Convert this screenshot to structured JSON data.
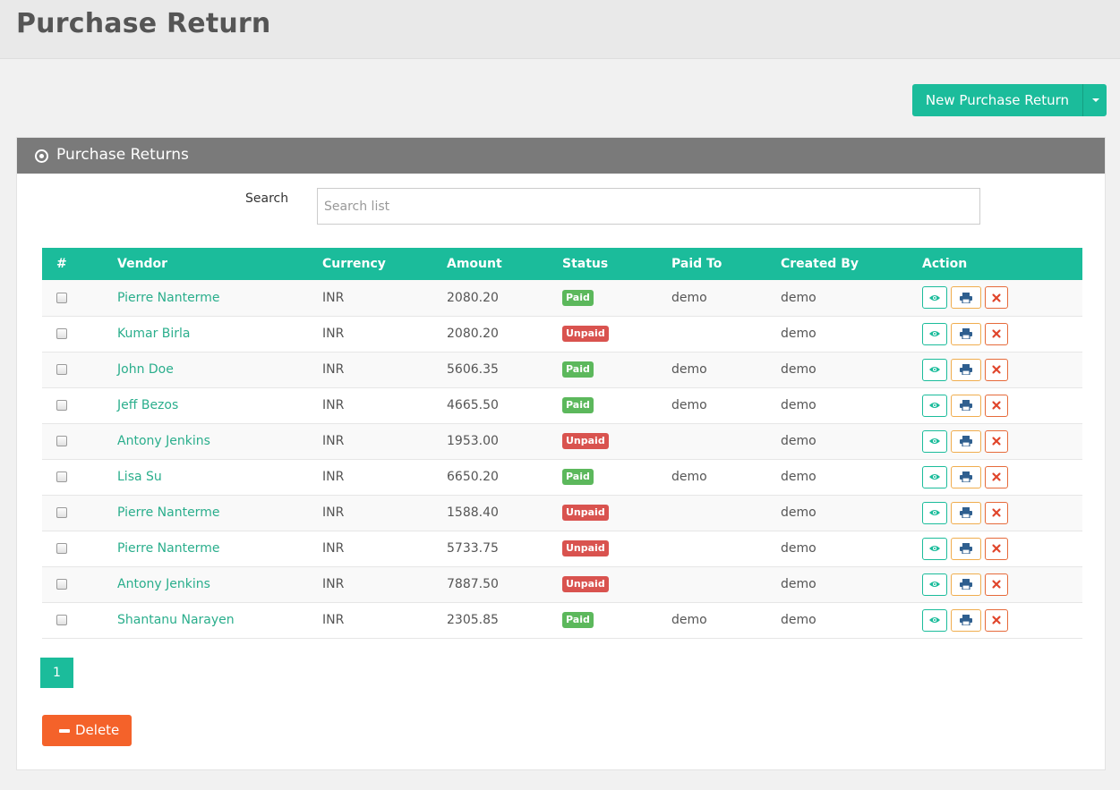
{
  "header": {
    "title": "Purchase Return"
  },
  "toolbar": {
    "new_label": "New Purchase Return"
  },
  "panel": {
    "title": "Purchase Returns"
  },
  "search": {
    "label": "Search",
    "placeholder": "Search list"
  },
  "table": {
    "columns": [
      "#",
      "Vendor",
      "Currency",
      "Amount",
      "Status",
      "Paid To",
      "Created By",
      "Action"
    ],
    "rows": [
      {
        "vendor": "Pierre Nanterme",
        "currency": "INR",
        "amount": "2080.20",
        "status": "Paid",
        "paid_to": "demo",
        "created_by": "demo"
      },
      {
        "vendor": "Kumar Birla",
        "currency": "INR",
        "amount": "2080.20",
        "status": "Unpaid",
        "paid_to": "",
        "created_by": "demo"
      },
      {
        "vendor": "John Doe",
        "currency": "INR",
        "amount": "5606.35",
        "status": "Paid",
        "paid_to": "demo",
        "created_by": "demo"
      },
      {
        "vendor": "Jeff Bezos",
        "currency": "INR",
        "amount": "4665.50",
        "status": "Paid",
        "paid_to": "demo",
        "created_by": "demo"
      },
      {
        "vendor": "Antony Jenkins",
        "currency": "INR",
        "amount": "1953.00",
        "status": "Unpaid",
        "paid_to": "",
        "created_by": "demo"
      },
      {
        "vendor": "Lisa Su",
        "currency": "INR",
        "amount": "6650.20",
        "status": "Paid",
        "paid_to": "demo",
        "created_by": "demo"
      },
      {
        "vendor": "Pierre Nanterme",
        "currency": "INR",
        "amount": "1588.40",
        "status": "Unpaid",
        "paid_to": "",
        "created_by": "demo"
      },
      {
        "vendor": "Pierre Nanterme",
        "currency": "INR",
        "amount": "5733.75",
        "status": "Unpaid",
        "paid_to": "",
        "created_by": "demo"
      },
      {
        "vendor": "Antony Jenkins",
        "currency": "INR",
        "amount": "7887.50",
        "status": "Unpaid",
        "paid_to": "",
        "created_by": "demo"
      },
      {
        "vendor": "Shantanu Narayen",
        "currency": "INR",
        "amount": "2305.85",
        "status": "Paid",
        "paid_to": "demo",
        "created_by": "demo"
      }
    ],
    "action_icons": [
      "eye-icon",
      "print-icon",
      "close-icon"
    ]
  },
  "pagination": {
    "current": "1"
  },
  "footer": {
    "delete_label": "Delete"
  },
  "colors": {
    "accent": "#1bbc9b",
    "paid": "#5cb85c",
    "unpaid": "#d9534f",
    "delete": "#f4622a",
    "panel_header": "#7a7a7a"
  }
}
